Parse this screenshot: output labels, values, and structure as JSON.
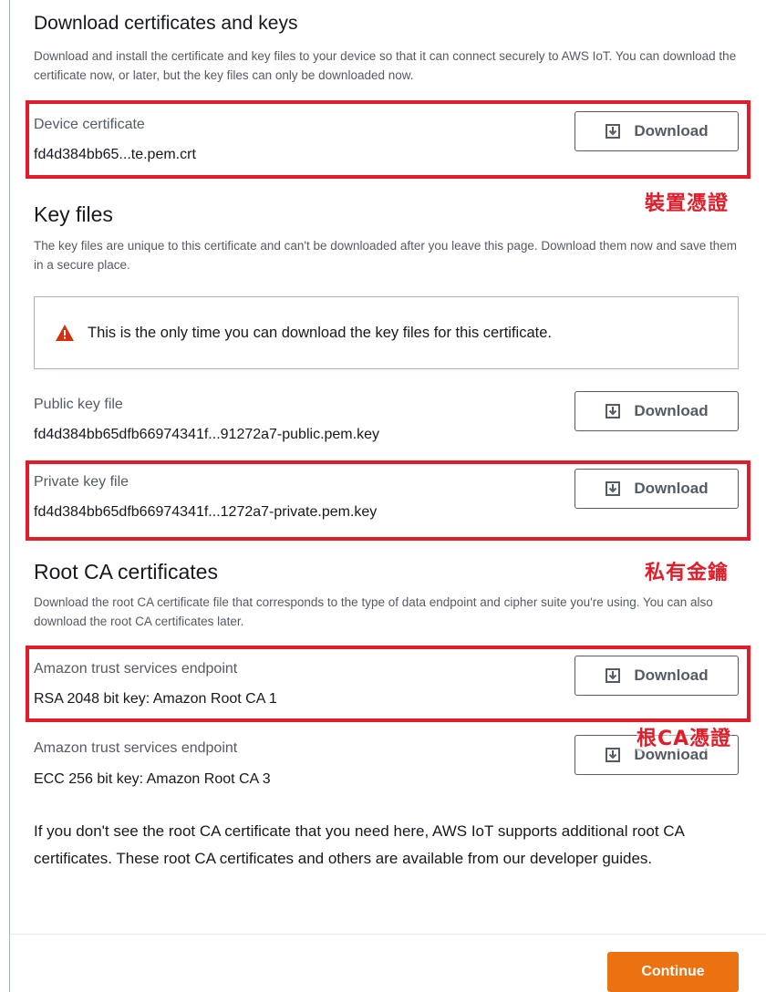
{
  "download_section": {
    "title": "Download certificates and keys",
    "description": "Download and install the certificate and key files to your device so that it can connect securely to AWS IoT. You can download the certificate now, or later, but the key files can only be downloaded now."
  },
  "device_certificate": {
    "label": "Device certificate",
    "filename": "fd4d384bb65...te.pem.crt",
    "button": "Download",
    "annotation": "裝置憑證"
  },
  "key_files": {
    "title": "Key files",
    "description": "The key files are unique to this certificate and can't be downloaded after you leave this page. Download them now and save them in a secure place.",
    "alert": "This is the only time you can download the key files for this certificate.",
    "public_key": {
      "label": "Public key file",
      "filename": "fd4d384bb65dfb66974341f...91272a7-public.pem.key",
      "button": "Download"
    },
    "private_key": {
      "label": "Private key file",
      "filename": "fd4d384bb65dfb66974341f...1272a7-private.pem.key",
      "button": "Download",
      "annotation": "私有金鑰"
    }
  },
  "root_ca": {
    "title": "Root CA certificates",
    "description": "Download the root CA certificate file that corresponds to the type of data endpoint and cipher suite you're using. You can also download the root CA certificates later.",
    "rsa": {
      "label": "Amazon trust services endpoint",
      "value": "RSA 2048 bit key: Amazon Root CA 1",
      "button": "Download",
      "annotation": "根CA憑證"
    },
    "ecc": {
      "label": "Amazon trust services endpoint",
      "value": "ECC 256 bit key: Amazon Root CA 3",
      "button": "Download"
    },
    "footer_note": "If you don't see the root CA certificate that you need here, AWS IoT supports additional root CA certificates. These root CA certificates and others are available from our developer guides."
  },
  "actions": {
    "continue": "Continue"
  },
  "colors": {
    "accent": "#ec7211",
    "highlight": "#e11d2a",
    "warning": "#d13212"
  },
  "icons": {
    "download": "download-icon",
    "warning": "warning-icon"
  }
}
